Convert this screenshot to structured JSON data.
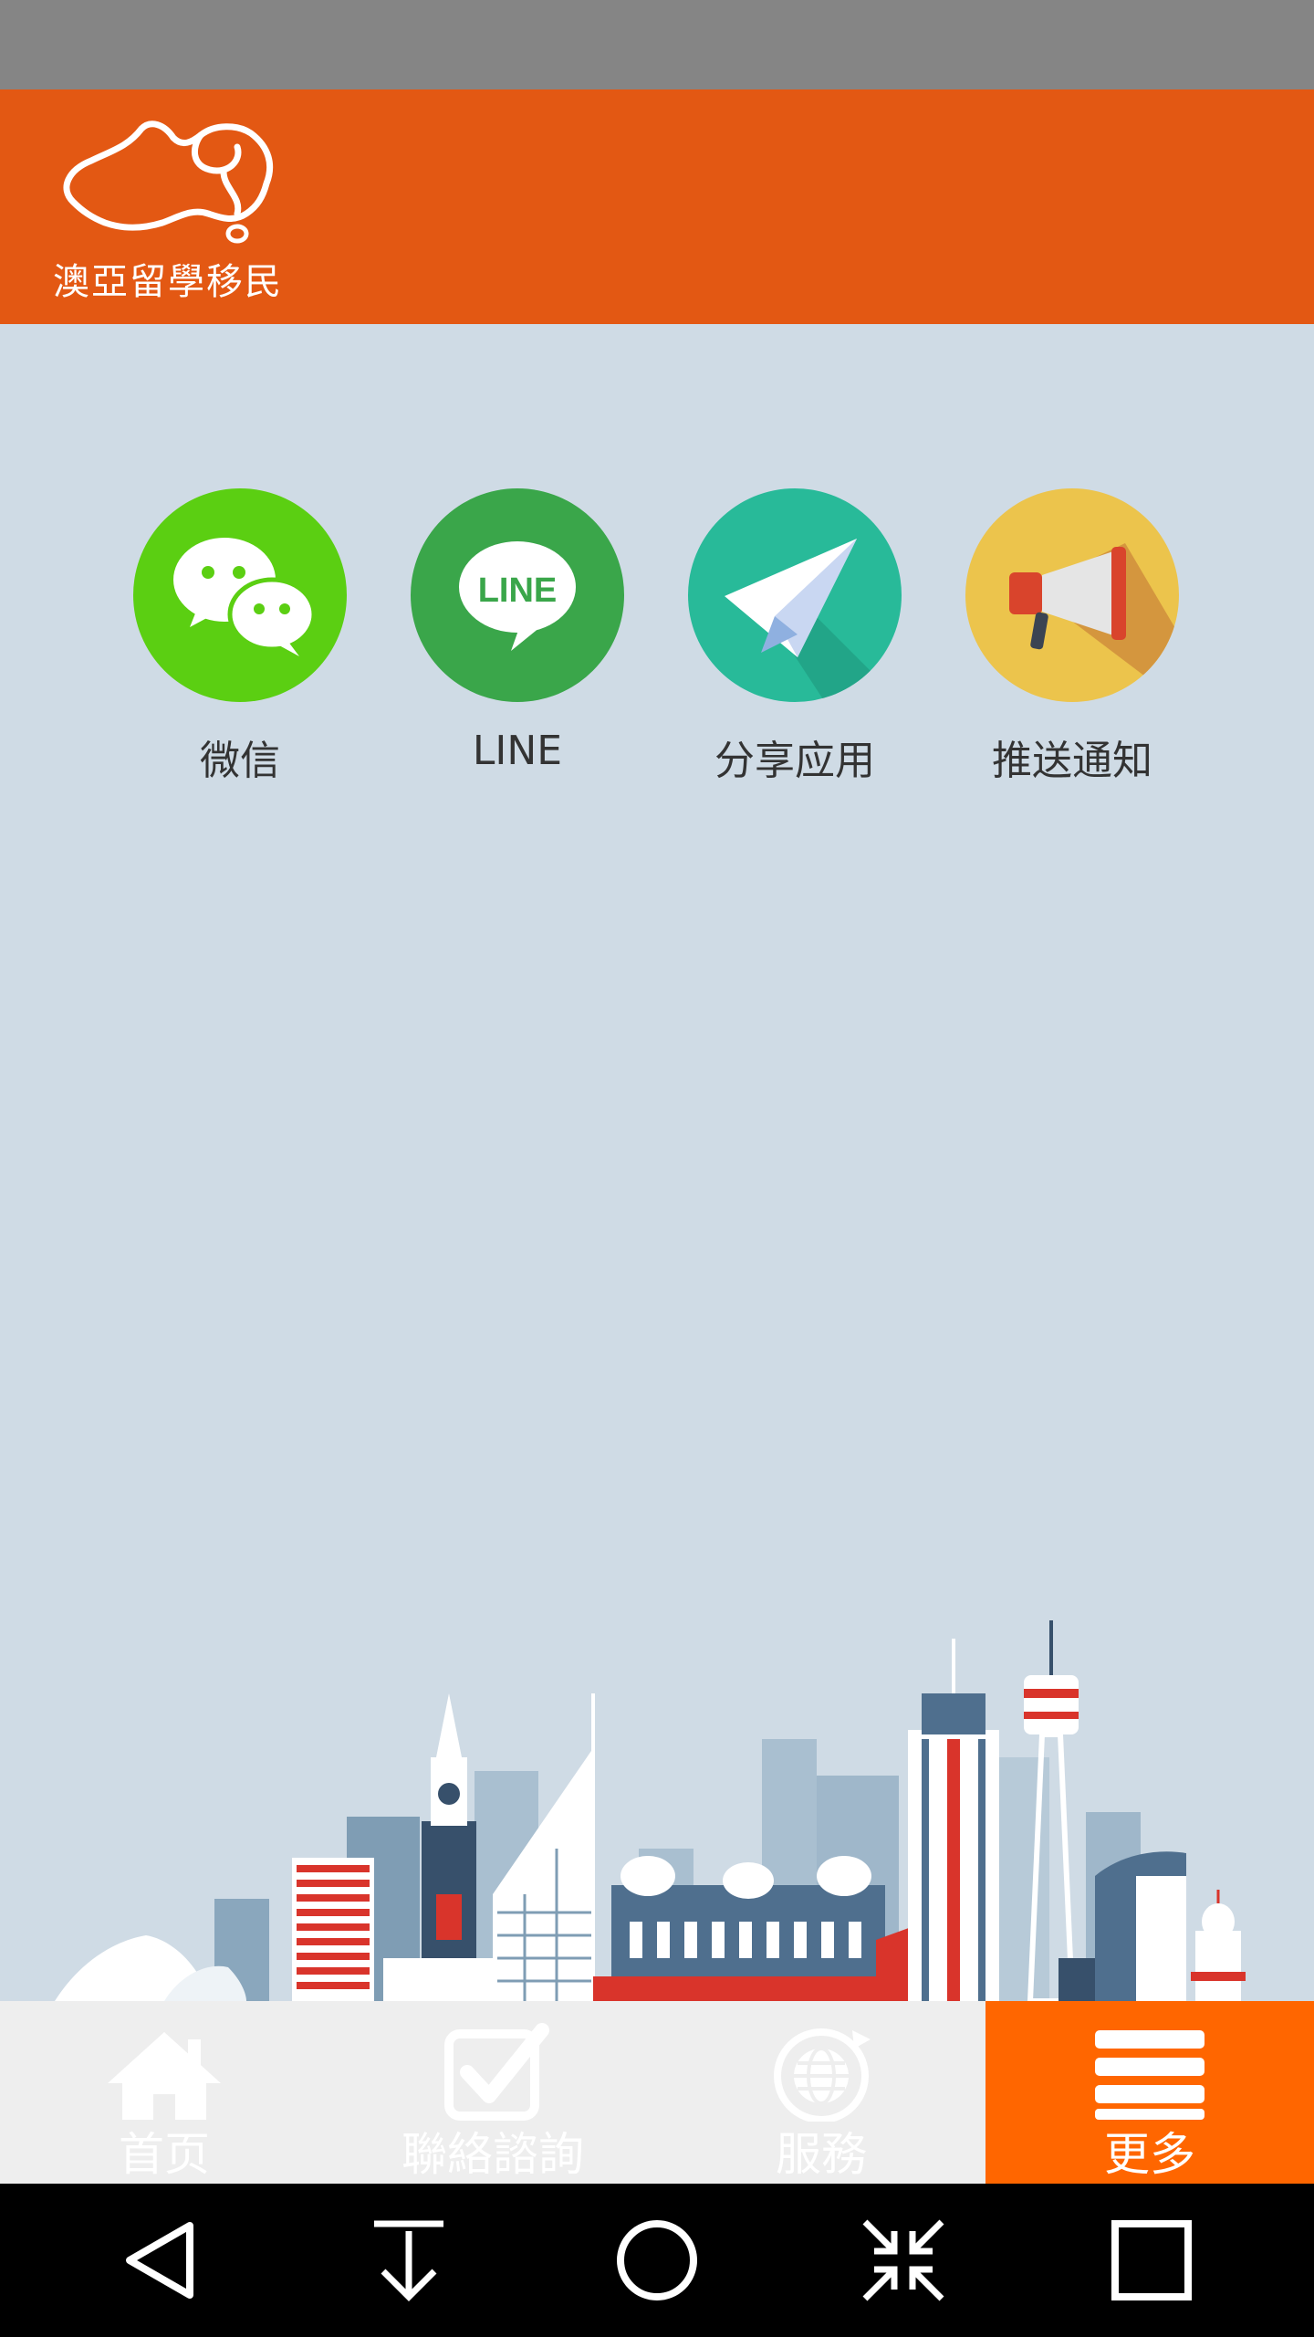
{
  "header": {
    "brand_text": "澳亞留學移民",
    "brand_color": "#e35813"
  },
  "share_options": [
    {
      "label": "微信",
      "icon": "wechat-icon",
      "color": "#5bcf12"
    },
    {
      "label": "LINE",
      "icon": "line-icon",
      "color": "#3aa64a",
      "badge": "LINE"
    },
    {
      "label": "分享应用",
      "icon": "paper-plane-icon",
      "color": "#28ba99"
    },
    {
      "label": "推送通知",
      "icon": "megaphone-icon",
      "color": "#ecc44c"
    }
  ],
  "tabs": [
    {
      "label": "首页",
      "icon": "home-icon",
      "active": false
    },
    {
      "label": "聯絡諮詢",
      "icon": "checkbox-icon",
      "active": false
    },
    {
      "label": "服務",
      "icon": "globe-icon",
      "active": false
    },
    {
      "label": "更多",
      "icon": "menu-icon",
      "active": true
    }
  ],
  "active_tab_color": "#ff6600",
  "system_nav": [
    {
      "icon": "back-icon"
    },
    {
      "icon": "download-icon"
    },
    {
      "icon": "home-circle-icon"
    },
    {
      "icon": "collapse-icon"
    },
    {
      "icon": "recents-icon"
    }
  ]
}
